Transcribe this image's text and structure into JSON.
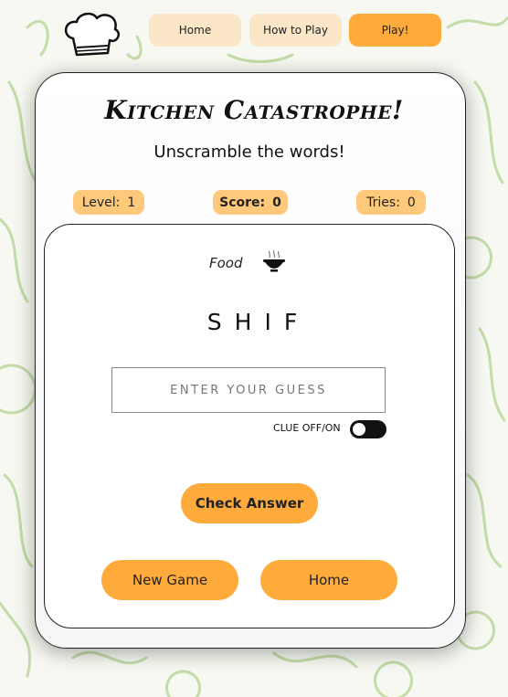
{
  "nav": {
    "home_label": "Home",
    "how_to_play_label": "How to Play",
    "play_label": "Play!"
  },
  "game": {
    "title": "Kitchen Catastrophe!",
    "subtitle": "Unscramble the words!",
    "level_label": "Level:",
    "level_value": "1",
    "score_label": "Score:",
    "score_value": "0",
    "tries_label": "Tries:",
    "tries_value": "0",
    "category": "Food",
    "category_icon": "food-bowl-icon",
    "scrambled_word": "SHIF",
    "guess_placeholder": "ENTER YOUR GUESS",
    "guess_value": "",
    "clue_label": "CLUE OFF/ON",
    "clue_on": false,
    "check_answer_label": "Check Answer",
    "new_game_label": "New Game",
    "home_label": "Home"
  },
  "colors": {
    "accent": "#ffab3c",
    "nav_inactive": "#fbe7c8",
    "pill": "#ffc97c",
    "background_pattern": "#b9d89b"
  }
}
